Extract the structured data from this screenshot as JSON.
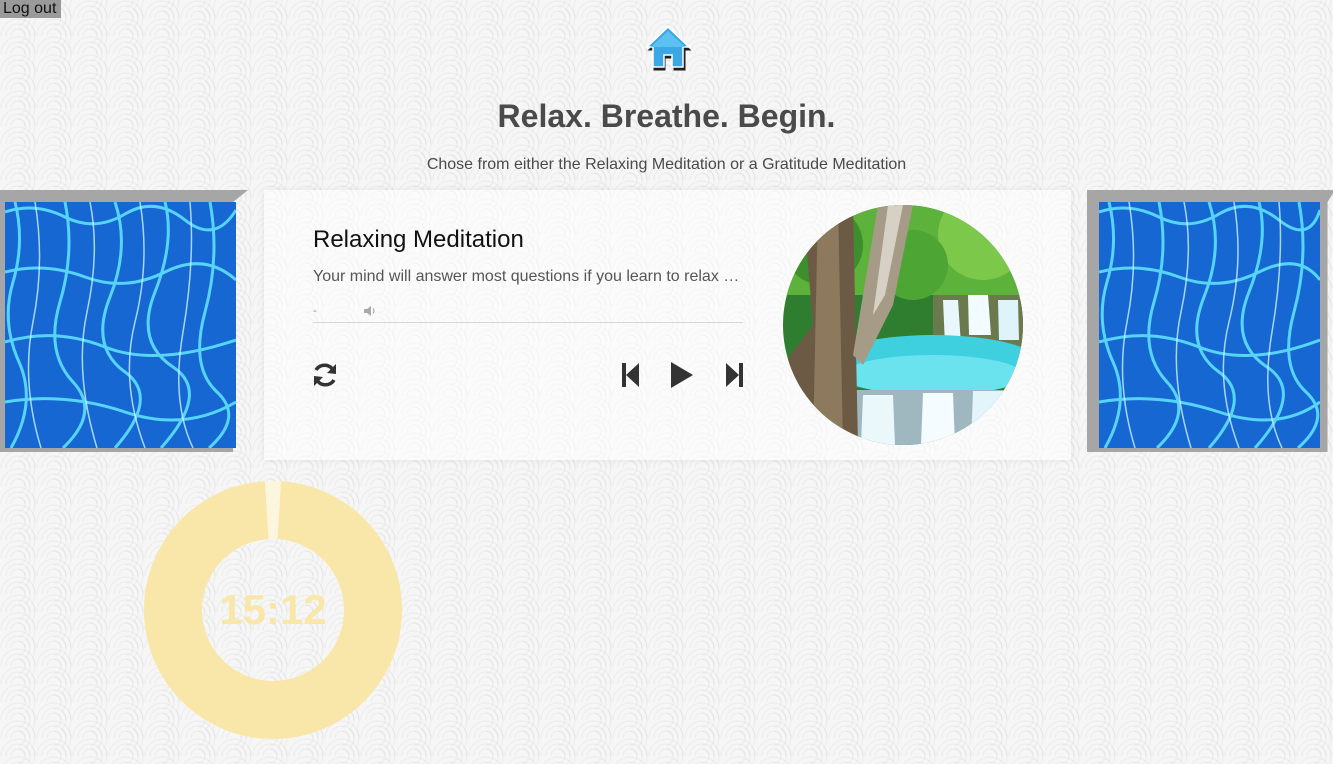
{
  "header": {
    "logout_label": "Log out",
    "home_icon": "home-icon",
    "title": "Relax. Breathe. Begin.",
    "subtitle": "Chose from either the Relaxing Meditation or a Gratitude Meditation"
  },
  "player": {
    "track_title": "Relaxing Meditation",
    "track_description": "Your mind will answer most questions if you learn to relax and wait for the answer.",
    "time_display": "-",
    "icons": {
      "volume": "volume-icon",
      "repeat": "repeat-icon",
      "previous": "skip-back-icon",
      "play": "play-icon",
      "next": "skip-forward-icon"
    },
    "cover_image": "waterfall-image"
  },
  "side_images": {
    "left": "water-image",
    "right": "water-image"
  },
  "timer": {
    "display": "15:12",
    "progress_fraction": 0.98,
    "color": "#f8e7a8"
  },
  "colors": {
    "text": "#4a4a4a",
    "frame": "#a6a6a6",
    "water": "#1b6fd8",
    "timer": "#f8e7a8"
  }
}
